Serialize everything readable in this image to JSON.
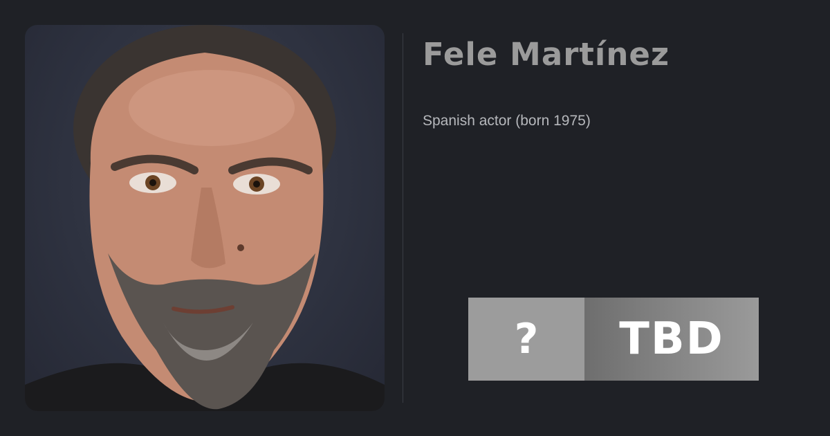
{
  "person": {
    "name": "Fele Martínez",
    "description": "Spanish actor (born 1975)"
  },
  "badge": {
    "symbol": "?",
    "label": "TBD"
  },
  "colors": {
    "background": "#1f2126",
    "name_text": "#9b9b9b",
    "description_text": "#b6b8bc",
    "badge_left": "#9c9c9c",
    "badge_right": "#7f7f7f"
  }
}
